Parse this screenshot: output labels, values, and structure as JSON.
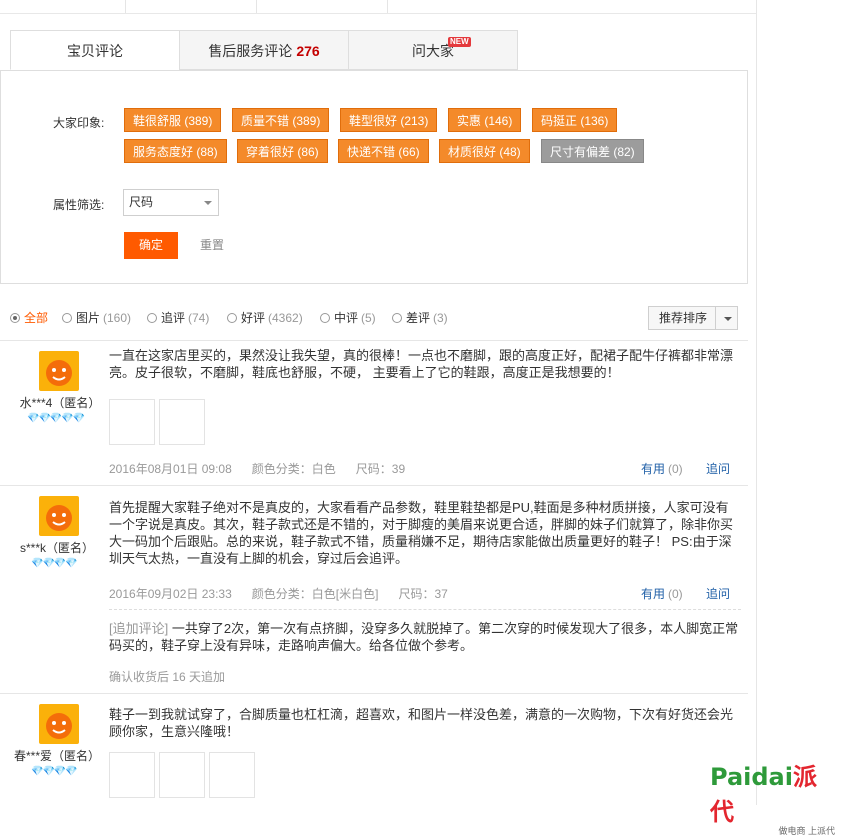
{
  "tabs": [
    {
      "label": "宝贝评论",
      "count": ""
    },
    {
      "label": "售后服务评论",
      "count": "276"
    },
    {
      "label": "问大家",
      "count": "",
      "badge": "NEW"
    }
  ],
  "impressions_label": "大家印象:",
  "impression_tags": [
    {
      "text": "鞋很舒服 (389)"
    },
    {
      "text": "质量不错 (389)"
    },
    {
      "text": "鞋型很好 (213)"
    },
    {
      "text": "实惠 (146)"
    },
    {
      "text": "码挺正 (136)"
    },
    {
      "text": "服务态度好 (88)"
    },
    {
      "text": "穿着很好 (86)"
    },
    {
      "text": "快递不错 (66)"
    },
    {
      "text": "材质很好 (48)"
    },
    {
      "text": "尺寸有偏差 (82)"
    }
  ],
  "attr_filter": {
    "label": "属性筛选:",
    "value": "尺码"
  },
  "buttons": {
    "confirm": "确定",
    "reset": "重置"
  },
  "radio_filters": [
    {
      "label": "全部",
      "count": ""
    },
    {
      "label": "图片",
      "count": "(160)"
    },
    {
      "label": "追评",
      "count": "(74)"
    },
    {
      "label": "好评",
      "count": "(4362)"
    },
    {
      "label": "中评",
      "count": "(5)"
    },
    {
      "label": "差评",
      "count": "(3)"
    }
  ],
  "sort": {
    "label": "推荐排序"
  },
  "reviews": [
    {
      "user": "水***4（匿名）",
      "hearts": "💎💎💎💎💎",
      "content": "一直在这家店里买的，果然没让我失望，真的很棒！一点也不磨脚，跟的高度正好，配裙子配牛仔裤都非常漂亮。皮子很软，不磨脚，鞋底也舒服，不硬， 主要看上了它的鞋跟，高度正是我想要的！",
      "date": "2016年08月01日 09:08",
      "color": "颜色分类：白色",
      "size": "尺码：39",
      "useful": "有用",
      "useful_count": "(0)",
      "reply": "追问"
    },
    {
      "user": "s***k（匿名）",
      "hearts": "💎💎💎💎",
      "content": "首先提醒大家鞋子绝对不是真皮的，大家看看产品参数，鞋里鞋垫都是PU,鞋面是多种材质拼接，人家可没有一个字说是真皮。其次，鞋子款式还是不错的，对于脚瘦的美眉来说更合适，胖脚的妹子们就算了，除非你买大一码加个后跟贴。总的来说，鞋子款式不错，质量稍嫌不足，期待店家能做出质量更好的鞋子！ PS:由于深圳天气太热，一直没有上脚的机会，穿过后会追评。",
      "date": "2016年09月02日 23:33",
      "color": "颜色分类：白色[米白色]",
      "size": "尺码：37",
      "useful": "有用",
      "useful_count": "(0)",
      "reply": "追问",
      "followup_tag": "[追加评论]",
      "followup": "一共穿了2次，第一次有点挤脚，没穿多久就脱掉了。第二次穿的时候发现大了很多，本人脚宽正常码买的，鞋子穿上没有异味，走路响声偏大。给各位做个参考。",
      "followup_meta": "确认收货后 16 天追加"
    },
    {
      "user": "春***爱（匿名）",
      "hearts": "💎💎💎💎",
      "content": "鞋子一到我就试穿了，合脚质量也杠杠滴，超喜欢，和图片一样没色差，满意的一次购物，下次有好货还会光顾你家，生意兴隆哦！"
    }
  ],
  "watermark": {
    "brand": "Paidai",
    "cn": "派代",
    "tagline": "做电商 上派代"
  },
  "colors": {
    "accent": "#ff5a00",
    "tag": "#f48a2a",
    "link": "#1f5fa7"
  }
}
